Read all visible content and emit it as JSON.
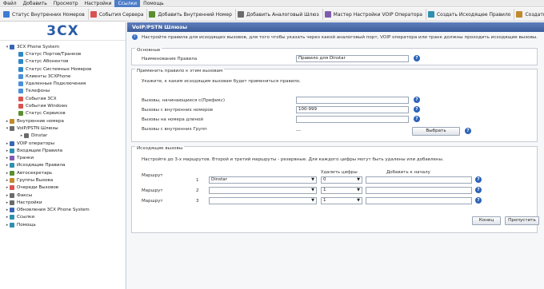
{
  "menubar": [
    "Файл",
    "Добавить",
    "Просмотр",
    "Настройки",
    "Ссылки",
    "Помощь"
  ],
  "toolbar": [
    {
      "label": "Статус Внутренних Номеров",
      "icon": "status-icon",
      "color": "#3b7bd4"
    },
    {
      "label": "События Сервера",
      "icon": "events-icon",
      "color": "#d9534f"
    },
    {
      "label": "Добавить Внутренний Номер",
      "icon": "add-extension-icon",
      "color": "#5a8f2e"
    },
    {
      "label": "Добавить Аналоговый Шлюз",
      "icon": "add-gateway-icon",
      "color": "#6b6b6b"
    },
    {
      "label": "Мастер Настройки VOIP Оператора",
      "icon": "wizard-icon",
      "color": "#7f5bb0"
    },
    {
      "label": "Создать Исходящее Правило",
      "icon": "outbound-rule-icon",
      "color": "#2f8fb0"
    },
    {
      "label": "Создать DID",
      "icon": "did-icon",
      "color": "#c18a2b"
    }
  ],
  "sidebar": {
    "logo": "3CX",
    "tree": [
      {
        "label": "3CX Phone System",
        "level": 0,
        "toggle": "▾",
        "icon": "phone-system-icon",
        "color": "#3866b3"
      },
      {
        "label": "Статус Портов/Транков",
        "level": 1,
        "toggle": "",
        "icon": "port-status-icon",
        "color": "#2f87c6"
      },
      {
        "label": "Статус Абонентов",
        "level": 1,
        "toggle": "",
        "icon": "subscriber-status-icon",
        "color": "#2f87c6"
      },
      {
        "label": "Статус Системных Номеров",
        "level": 1,
        "toggle": "",
        "icon": "system-numbers-icon",
        "color": "#2f87c6"
      },
      {
        "label": "Клиенты 3CXPhone",
        "level": 1,
        "toggle": "",
        "icon": "clients-icon",
        "color": "#4a90d9"
      },
      {
        "label": "Удаленные Подключения",
        "level": 1,
        "toggle": "",
        "icon": "remote-connections-icon",
        "color": "#4a90d9"
      },
      {
        "label": "Телефоны",
        "level": 1,
        "toggle": "",
        "icon": "phones-icon",
        "color": "#4a90d9"
      },
      {
        "label": "События 3CX",
        "level": 1,
        "toggle": "",
        "icon": "events-3cx-icon",
        "color": "#d9534f"
      },
      {
        "label": "События Windows",
        "level": 1,
        "toggle": "",
        "icon": "windows-events-icon",
        "color": "#d9534f"
      },
      {
        "label": "Статус Сервисов",
        "level": 1,
        "toggle": "",
        "icon": "services-status-icon",
        "color": "#5a8f2e"
      },
      {
        "label": "Внутренние номера",
        "level": 0,
        "toggle": "▸",
        "icon": "extensions-icon",
        "color": "#c18a2b"
      },
      {
        "label": "VoIP/PSTN Шлюзы",
        "level": 0,
        "toggle": "▾",
        "icon": "gateways-icon",
        "color": "#6b6b6b"
      },
      {
        "label": "Dinstar",
        "level": 1,
        "toggle": "▸",
        "icon": "gateway-device-icon",
        "color": "#6b6b6b"
      },
      {
        "label": "VOIP операторы",
        "level": 0,
        "toggle": "▸",
        "icon": "voip-providers-icon",
        "color": "#3866b3"
      },
      {
        "label": "Входящие Правила",
        "level": 0,
        "toggle": "▸",
        "icon": "inbound-rules-icon",
        "color": "#2f8fb0"
      },
      {
        "label": "Транки",
        "level": 0,
        "toggle": "▸",
        "icon": "trunks-icon",
        "color": "#7f5bb0"
      },
      {
        "label": "Исходящие Правила",
        "level": 0,
        "toggle": "▸",
        "icon": "outbound-rules-icon",
        "color": "#2f8fb0"
      },
      {
        "label": "Автосекретарь",
        "level": 0,
        "toggle": "▸",
        "icon": "auto-attendant-icon",
        "color": "#5a8f2e"
      },
      {
        "label": "Группы Вызова",
        "level": 0,
        "toggle": "▸",
        "icon": "ring-groups-icon",
        "color": "#c18a2b"
      },
      {
        "label": "Очереди Вызовов",
        "level": 0,
        "toggle": "▸",
        "icon": "call-queues-icon",
        "color": "#d9534f"
      },
      {
        "label": "Факсы",
        "level": 0,
        "toggle": "▸",
        "icon": "fax-icon",
        "color": "#6b6b6b"
      },
      {
        "label": "Настройки",
        "level": 0,
        "toggle": "▸",
        "icon": "settings-icon",
        "color": "#6b6b6b"
      },
      {
        "label": "Обновления 3CX Phone System",
        "level": 0,
        "toggle": "▸",
        "icon": "updates-icon",
        "color": "#3866b3"
      },
      {
        "label": "Ссылки",
        "level": 0,
        "toggle": "▸",
        "icon": "links-icon",
        "color": "#2f8fb0"
      },
      {
        "label": "Помощь",
        "level": 0,
        "toggle": "▸",
        "icon": "help-icon",
        "color": "#2f8fb0"
      }
    ]
  },
  "main": {
    "title": "VoIP/PSTN Шлюзы",
    "intro": "Настройте правила для исходящих вызовов, для того чтобы указать через какой аналоговый порт, VOIP оператора или транк должны проходить исходящие вызовы.",
    "basic": {
      "title": "Основные",
      "name_label": "Наименование Правила",
      "name_value": "Правило для Dinstar"
    },
    "apply": {
      "title": "Применить правило к этим вызовам",
      "desc": "Укажите, к каким исходящим вызовам будет применяться правило.",
      "prefix_label": "Вызовы, начинающиеся с(Префикс)",
      "prefix_value": "",
      "ext_label": "Вызовы с внутренних номеров",
      "ext_value": "100-999",
      "length_label": "Вызовы на номера длиной",
      "length_value": "",
      "groups_label": "Вызовы с внутренних Групп",
      "groups_value": "---",
      "select_button": "Выбрать"
    },
    "routes": {
      "title": "Исходящие вызовы",
      "desc": "Настройте до 3-х маршрутов. Второй и третий маршруты - резервные. Для каждого цифры могут быть удалены или добавлены.",
      "strip_header": "Удалить цифры",
      "prepend_header": "Добавить к началу",
      "rows": [
        {
          "label": "Маршрут",
          "num": "1",
          "route": "Dinstar",
          "strip": "0",
          "prepend": ""
        },
        {
          "label": "Маршрут",
          "num": "2",
          "route": "",
          "strip": "1",
          "prepend": ""
        },
        {
          "label": "Маршрут",
          "num": "3",
          "route": "",
          "strip": "1",
          "prepend": ""
        }
      ]
    },
    "cancel_button": "Конец",
    "skip_button": "Пропустить"
  }
}
